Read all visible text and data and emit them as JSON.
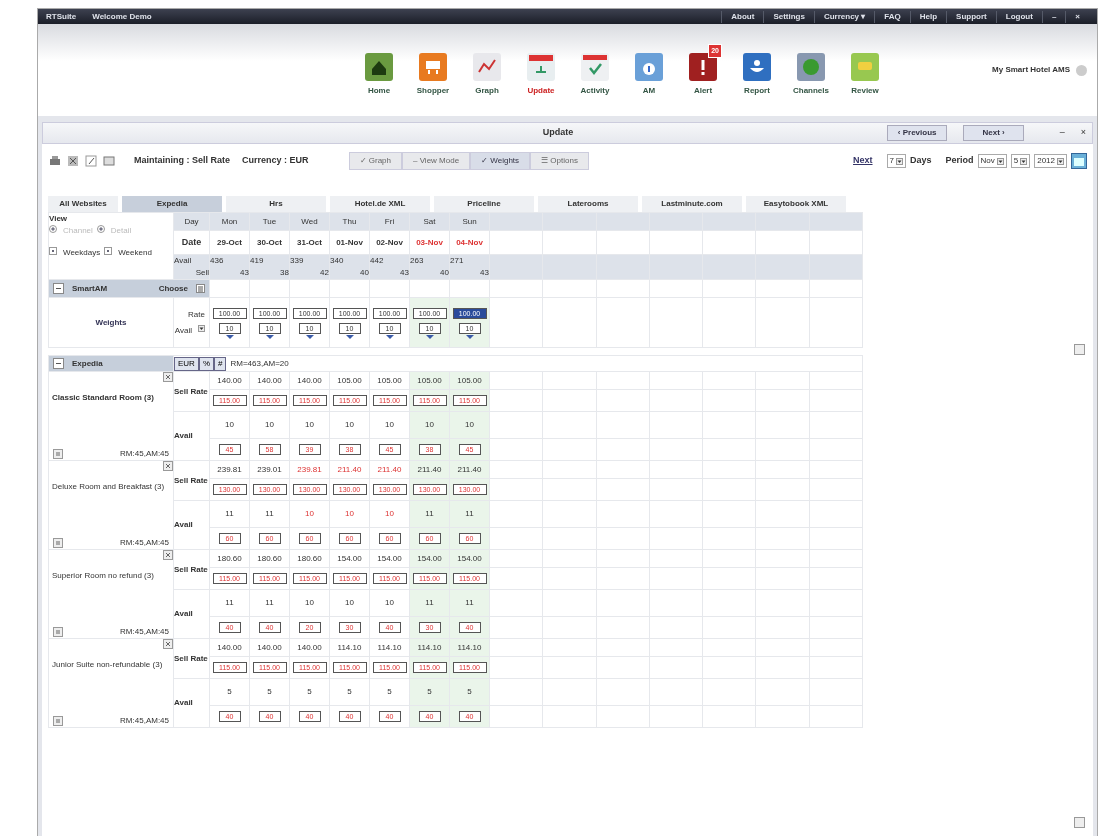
{
  "window": {
    "app_title": "RTSuite",
    "welcome": "Welcome Demo",
    "menu": [
      {
        "label": "About"
      },
      {
        "label": "Settings"
      },
      {
        "label": "Currency ▾"
      },
      {
        "label": "FAQ"
      },
      {
        "label": "Help"
      },
      {
        "label": "Support"
      },
      {
        "label": "Logout"
      }
    ],
    "controls": [
      "–",
      "×"
    ]
  },
  "toolbar": {
    "brand": "My Smart Hotel AMS",
    "items": [
      {
        "label": "Home",
        "selected": false
      },
      {
        "label": "Shopper",
        "selected": false
      },
      {
        "label": "Graph",
        "selected": false
      },
      {
        "label": "Update",
        "selected": true
      },
      {
        "label": "Activity",
        "selected": false
      },
      {
        "label": "AM",
        "selected": false
      },
      {
        "label": "Alert",
        "selected": false,
        "badge": "20"
      },
      {
        "label": "Report",
        "selected": false
      },
      {
        "label": "Channels",
        "selected": false
      },
      {
        "label": "Review",
        "selected": false
      }
    ]
  },
  "panel": {
    "title": "Update",
    "previous": "‹ Previous",
    "next": "Next ›",
    "controls": [
      "–",
      "×"
    ]
  },
  "options": {
    "maintaining": "Maintaining : Sell Rate",
    "currency": "Currency : EUR",
    "tabs": [
      {
        "glyph": "✓",
        "label": "Graph",
        "checked": false
      },
      {
        "glyph": "–",
        "label": "View Mode",
        "checked": false
      },
      {
        "glyph": "✓",
        "label": "Weights",
        "checked": true
      },
      {
        "glyph": "☰",
        "label": "Options",
        "checked": false
      }
    ],
    "next_link": "Next",
    "days_value": "7",
    "days_label": "Days",
    "period_label": "Period",
    "month": "Nov",
    "day": "5",
    "year": "2012"
  },
  "websites": [
    {
      "label": "All Websites",
      "selected": false
    },
    {
      "label": "Expedia",
      "selected": true
    },
    {
      "label": "Hrs",
      "selected": false
    },
    {
      "label": "Hotel.de XML",
      "selected": false
    },
    {
      "label": "Priceline",
      "selected": false
    },
    {
      "label": "Laterooms",
      "selected": false
    },
    {
      "label": "Lastminute.com",
      "selected": false
    },
    {
      "label": "Easytobook XML",
      "selected": false
    }
  ],
  "grid": {
    "view_label": "View",
    "view_options": [
      {
        "label": "Channel",
        "selected": true,
        "disabled": true
      },
      {
        "label": "Detail",
        "selected": true,
        "disabled": true
      }
    ],
    "filters": [
      {
        "label": "Weekdays",
        "checked": true
      },
      {
        "label": "Weekend",
        "checked": true
      }
    ],
    "day_label": "Day",
    "date_label": "Date",
    "avail_label": "Avail",
    "sell_label": "Sell",
    "days": [
      {
        "day": "Mon",
        "date": "29-Oct",
        "avail": "436",
        "sell": "43",
        "weekend": false
      },
      {
        "day": "Tue",
        "date": "30-Oct",
        "avail": "419",
        "sell": "38",
        "weekend": false
      },
      {
        "day": "Wed",
        "date": "31-Oct",
        "avail": "339",
        "sell": "42",
        "weekend": false
      },
      {
        "day": "Thu",
        "date": "01-Nov",
        "avail": "340",
        "sell": "40",
        "weekend": false
      },
      {
        "day": "Fri",
        "date": "02-Nov",
        "avail": "442",
        "sell": "43",
        "weekend": false
      },
      {
        "day": "Sat",
        "date": "03-Nov",
        "avail": "263",
        "sell": "40",
        "weekend": true
      },
      {
        "day": "Sun",
        "date": "04-Nov",
        "avail": "271",
        "sell": "43",
        "weekend": true
      }
    ]
  },
  "smartam": {
    "title": "SmartAM",
    "choose": "Choose"
  },
  "weights": {
    "title": "Weights",
    "rate_label": "Rate",
    "avail_label": "Avail",
    "rates": [
      {
        "value": "100.00",
        "focused": false
      },
      {
        "value": "100.00",
        "focused": false
      },
      {
        "value": "100.00",
        "focused": false
      },
      {
        "value": "100.00",
        "focused": false
      },
      {
        "value": "100.00",
        "focused": false
      },
      {
        "value": "100.00",
        "focused": false
      },
      {
        "value": "100.00",
        "focused": true
      }
    ],
    "avails": [
      "10",
      "10",
      "10",
      "10",
      "10",
      "10",
      "10"
    ]
  },
  "channel": {
    "name": "Expedia",
    "buttons": [
      "EUR",
      "%",
      "#"
    ],
    "summary": "RM=463,AM=20",
    "rooms": [
      {
        "name": "Classic Standard Room (3)",
        "highlighted": true,
        "summary": "RM:45,AM:45",
        "sell_label": "Sell Rate",
        "avail_label": "Avail",
        "cells": [
          {
            "rate": "140.00",
            "rate_alert": false,
            "price": "115.00",
            "avail": "10",
            "avail_alert": false,
            "allot": "45"
          },
          {
            "rate": "140.00",
            "rate_alert": false,
            "price": "115.00",
            "avail": "10",
            "avail_alert": false,
            "allot": "58"
          },
          {
            "rate": "140.00",
            "rate_alert": false,
            "price": "115.00",
            "avail": "10",
            "avail_alert": false,
            "allot": "39"
          },
          {
            "rate": "105.00",
            "rate_alert": false,
            "price": "115.00",
            "avail": "10",
            "avail_alert": false,
            "allot": "38"
          },
          {
            "rate": "105.00",
            "rate_alert": false,
            "price": "115.00",
            "avail": "10",
            "avail_alert": false,
            "allot": "45"
          },
          {
            "rate": "105.00",
            "rate_alert": false,
            "price": "115.00",
            "avail": "10",
            "avail_alert": false,
            "allot": "38"
          },
          {
            "rate": "105.00",
            "rate_alert": false,
            "price": "115.00",
            "avail": "10",
            "avail_alert": false,
            "allot": "45"
          }
        ]
      },
      {
        "name": "Deluxe Room and Breakfast (3)",
        "highlighted": false,
        "summary": "RM:45,AM:45",
        "sell_label": "Sell Rate",
        "avail_label": "Avail",
        "cells": [
          {
            "rate": "239.81",
            "rate_alert": false,
            "price": "130.00",
            "avail": "11",
            "avail_alert": false,
            "allot": "60"
          },
          {
            "rate": "239.01",
            "rate_alert": false,
            "price": "130.00",
            "avail": "11",
            "avail_alert": false,
            "allot": "60"
          },
          {
            "rate": "239.81",
            "rate_alert": true,
            "price": "130.00",
            "avail": "10",
            "avail_alert": true,
            "allot": "60"
          },
          {
            "rate": "211.40",
            "rate_alert": true,
            "price": "130.00",
            "avail": "10",
            "avail_alert": true,
            "allot": "60"
          },
          {
            "rate": "211.40",
            "rate_alert": true,
            "price": "130.00",
            "avail": "10",
            "avail_alert": true,
            "allot": "60"
          },
          {
            "rate": "211.40",
            "rate_alert": false,
            "price": "130.00",
            "avail": "11",
            "avail_alert": false,
            "allot": "60"
          },
          {
            "rate": "211.40",
            "rate_alert": false,
            "price": "130.00",
            "avail": "11",
            "avail_alert": false,
            "allot": "60"
          }
        ]
      },
      {
        "name": "Superior Room no refund (3)",
        "highlighted": false,
        "summary": "RM:45,AM:45",
        "sell_label": "Sell Rate",
        "avail_label": "Avail",
        "cells": [
          {
            "rate": "180.60",
            "rate_alert": false,
            "price": "115.00",
            "avail": "11",
            "avail_alert": false,
            "allot": "40"
          },
          {
            "rate": "180.60",
            "rate_alert": false,
            "price": "115.00",
            "avail": "11",
            "avail_alert": false,
            "allot": "40"
          },
          {
            "rate": "180.60",
            "rate_alert": false,
            "price": "115.00",
            "avail": "10",
            "avail_alert": false,
            "allot": "20"
          },
          {
            "rate": "154.00",
            "rate_alert": false,
            "price": "115.00",
            "avail": "10",
            "avail_alert": false,
            "allot": "30"
          },
          {
            "rate": "154.00",
            "rate_alert": false,
            "price": "115.00",
            "avail": "10",
            "avail_alert": false,
            "allot": "40"
          },
          {
            "rate": "154.00",
            "rate_alert": false,
            "price": "115.00",
            "avail": "11",
            "avail_alert": false,
            "allot": "30"
          },
          {
            "rate": "154.00",
            "rate_alert": false,
            "price": "115.00",
            "avail": "11",
            "avail_alert": false,
            "allot": "40"
          }
        ]
      },
      {
        "name": "Junior Suite non-refundable (3)",
        "highlighted": false,
        "summary": "RM:45,AM:45",
        "sell_label": "Sell Rate",
        "avail_label": "Avail",
        "cells": [
          {
            "rate": "140.00",
            "rate_alert": false,
            "price": "115.00",
            "avail": "5",
            "avail_alert": false,
            "allot": "40"
          },
          {
            "rate": "140.00",
            "rate_alert": false,
            "price": "115.00",
            "avail": "5",
            "avail_alert": false,
            "allot": "40"
          },
          {
            "rate": "140.00",
            "rate_alert": false,
            "price": "115.00",
            "avail": "5",
            "avail_alert": false,
            "allot": "40"
          },
          {
            "rate": "114.10",
            "rate_alert": false,
            "price": "115.00",
            "avail": "5",
            "avail_alert": false,
            "allot": "40"
          },
          {
            "rate": "114.10",
            "rate_alert": false,
            "price": "115.00",
            "avail": "5",
            "avail_alert": false,
            "allot": "40"
          },
          {
            "rate": "114.10",
            "rate_alert": false,
            "price": "115.00",
            "avail": "5",
            "avail_alert": false,
            "allot": "40"
          },
          {
            "rate": "114.10",
            "rate_alert": false,
            "price": "115.00",
            "avail": "5",
            "avail_alert": false,
            "allot": "40"
          }
        ]
      }
    ]
  }
}
